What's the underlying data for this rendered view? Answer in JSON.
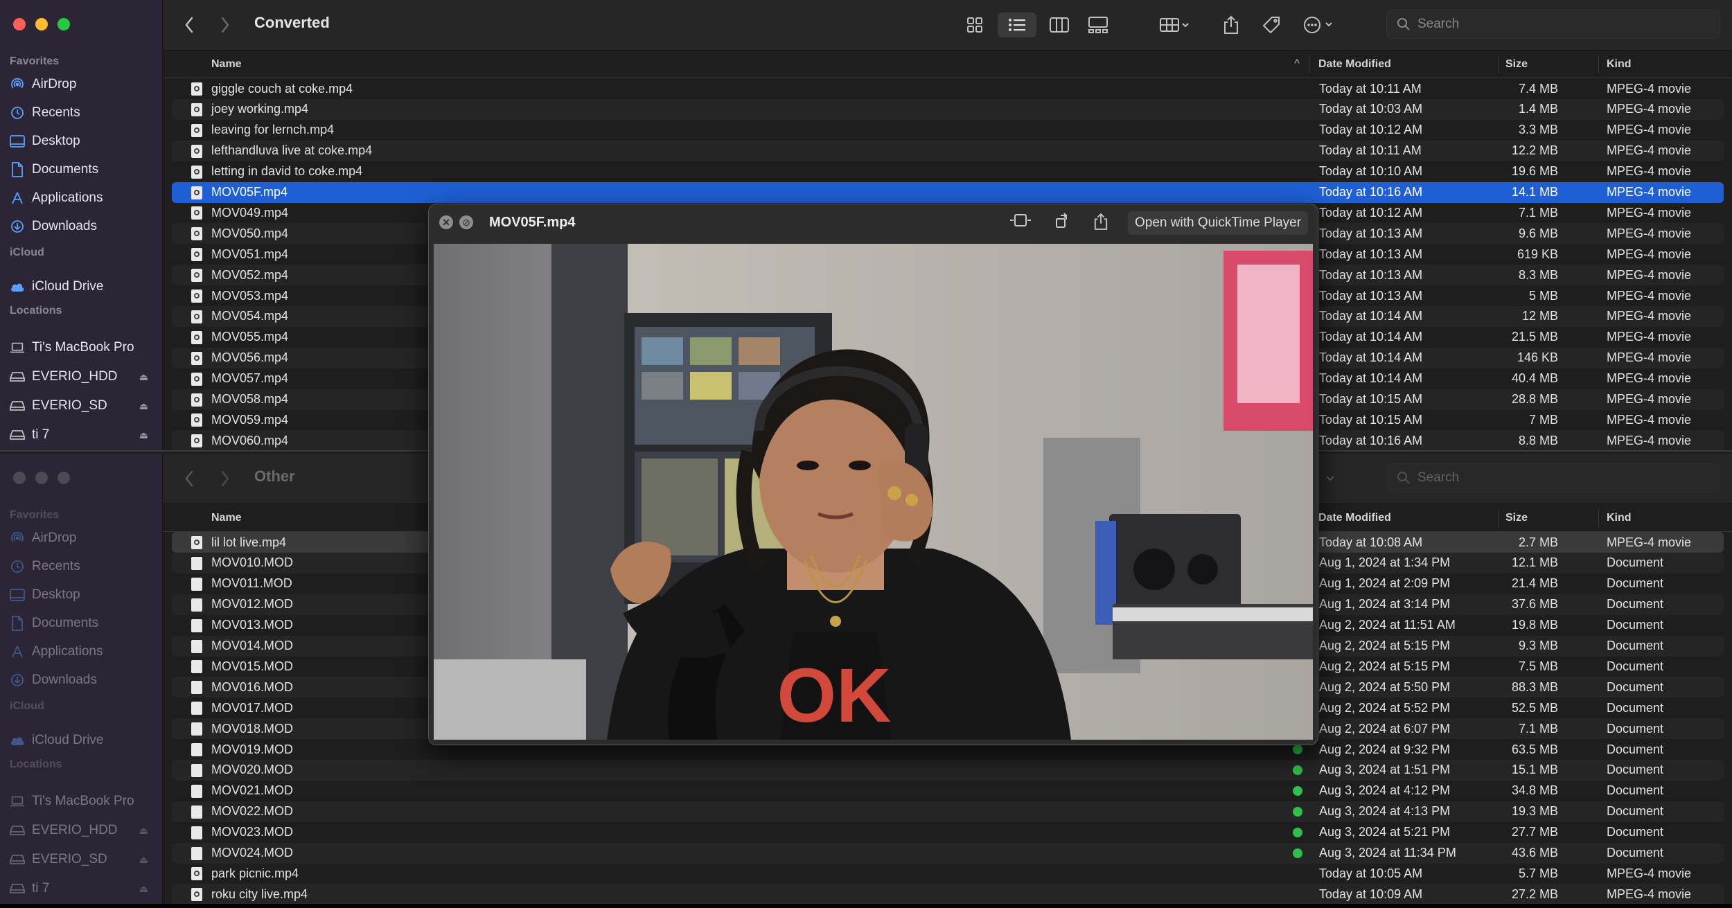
{
  "window1": {
    "title": "Converted",
    "search_placeholder": "Search",
    "columns": {
      "name": "Name",
      "date": "Date Modified",
      "size": "Size",
      "kind": "Kind"
    },
    "rows": [
      {
        "name": "giggle couch at coke.mp4",
        "date": "Today at 10:11 AM",
        "size": "7.4 MB",
        "kind": "MPEG-4 movie"
      },
      {
        "name": "joey working.mp4",
        "date": "Today at 10:03 AM",
        "size": "1.4 MB",
        "kind": "MPEG-4 movie"
      },
      {
        "name": "leaving for lernch.mp4",
        "date": "Today at 10:12 AM",
        "size": "3.3 MB",
        "kind": "MPEG-4 movie"
      },
      {
        "name": "lefthandluva live at coke.mp4",
        "date": "Today at 10:11 AM",
        "size": "12.2 MB",
        "kind": "MPEG-4 movie"
      },
      {
        "name": "letting in david to coke.mp4",
        "date": "Today at 10:10 AM",
        "size": "19.6 MB",
        "kind": "MPEG-4 movie"
      },
      {
        "name": "MOV05F.mp4",
        "date": "Today at 10:16 AM",
        "size": "14.1 MB",
        "kind": "MPEG-4 movie"
      },
      {
        "name": "MOV049.mp4",
        "date": "Today at 10:12 AM",
        "size": "7.1 MB",
        "kind": "MPEG-4 movie"
      },
      {
        "name": "MOV050.mp4",
        "date": "Today at 10:13 AM",
        "size": "9.6 MB",
        "kind": "MPEG-4 movie"
      },
      {
        "name": "MOV051.mp4",
        "date": "Today at 10:13 AM",
        "size": "619 KB",
        "kind": "MPEG-4 movie"
      },
      {
        "name": "MOV052.mp4",
        "date": "Today at 10:13 AM",
        "size": "8.3 MB",
        "kind": "MPEG-4 movie"
      },
      {
        "name": "MOV053.mp4",
        "date": "Today at 10:13 AM",
        "size": "5 MB",
        "kind": "MPEG-4 movie"
      },
      {
        "name": "MOV054.mp4",
        "date": "Today at 10:14 AM",
        "size": "12 MB",
        "kind": "MPEG-4 movie"
      },
      {
        "name": "MOV055.mp4",
        "date": "Today at 10:14 AM",
        "size": "21.5 MB",
        "kind": "MPEG-4 movie"
      },
      {
        "name": "MOV056.mp4",
        "date": "Today at 10:14 AM",
        "size": "146 KB",
        "kind": "MPEG-4 movie"
      },
      {
        "name": "MOV057.mp4",
        "date": "Today at 10:14 AM",
        "size": "40.4 MB",
        "kind": "MPEG-4 movie"
      },
      {
        "name": "MOV058.mp4",
        "date": "Today at 10:15 AM",
        "size": "28.8 MB",
        "kind": "MPEG-4 movie"
      },
      {
        "name": "MOV059.mp4",
        "date": "Today at 10:15 AM",
        "size": "7 MB",
        "kind": "MPEG-4 movie"
      },
      {
        "name": "MOV060.mp4",
        "date": "Today at 10:16 AM",
        "size": "8.8 MB",
        "kind": "MPEG-4 movie"
      }
    ]
  },
  "window2": {
    "title": "Other",
    "search_placeholder": "Search",
    "columns": {
      "name": "Name",
      "date": "Date Modified",
      "size": "Size",
      "kind": "Kind"
    },
    "rows": [
      {
        "name": "lil lot live.mp4",
        "date": "Today at 10:08 AM",
        "size": "2.7 MB",
        "kind": "MPEG-4 movie",
        "tag": false
      },
      {
        "name": "MOV010.MOD",
        "date": "Aug 1, 2024 at 1:34 PM",
        "size": "12.1 MB",
        "kind": "Document",
        "tag": false
      },
      {
        "name": "MOV011.MOD",
        "date": "Aug 1, 2024 at 2:09 PM",
        "size": "21.4 MB",
        "kind": "Document",
        "tag": false
      },
      {
        "name": "MOV012.MOD",
        "date": "Aug 1, 2024 at 3:14 PM",
        "size": "37.6 MB",
        "kind": "Document",
        "tag": false
      },
      {
        "name": "MOV013.MOD",
        "date": "Aug 2, 2024 at 11:51 AM",
        "size": "19.8 MB",
        "kind": "Document",
        "tag": false
      },
      {
        "name": "MOV014.MOD",
        "date": "Aug 2, 2024 at 5:15 PM",
        "size": "9.3 MB",
        "kind": "Document",
        "tag": false
      },
      {
        "name": "MOV015.MOD",
        "date": "Aug 2, 2024 at 5:15 PM",
        "size": "7.5 MB",
        "kind": "Document",
        "tag": false
      },
      {
        "name": "MOV016.MOD",
        "date": "Aug 2, 2024 at 5:50 PM",
        "size": "88.3 MB",
        "kind": "Document",
        "tag": false
      },
      {
        "name": "MOV017.MOD",
        "date": "Aug 2, 2024 at 5:52 PM",
        "size": "52.5 MB",
        "kind": "Document",
        "tag": false
      },
      {
        "name": "MOV018.MOD",
        "date": "Aug 2, 2024 at 6:07 PM",
        "size": "7.1 MB",
        "kind": "Document",
        "tag": false
      },
      {
        "name": "MOV019.MOD",
        "date": "Aug 2, 2024 at 9:32 PM",
        "size": "63.5 MB",
        "kind": "Document",
        "tag": true
      },
      {
        "name": "MOV020.MOD",
        "date": "Aug 3, 2024 at 1:51 PM",
        "size": "15.1 MB",
        "kind": "Document",
        "tag": true
      },
      {
        "name": "MOV021.MOD",
        "date": "Aug 3, 2024 at 4:12 PM",
        "size": "34.8 MB",
        "kind": "Document",
        "tag": true
      },
      {
        "name": "MOV022.MOD",
        "date": "Aug 3, 2024 at 4:13 PM",
        "size": "19.3 MB",
        "kind": "Document",
        "tag": true
      },
      {
        "name": "MOV023.MOD",
        "date": "Aug 3, 2024 at 5:21 PM",
        "size": "27.7 MB",
        "kind": "Document",
        "tag": true
      },
      {
        "name": "MOV024.MOD",
        "date": "Aug 3, 2024 at 11:34 PM",
        "size": "43.6 MB",
        "kind": "Document",
        "tag": true
      },
      {
        "name": "park picnic.mp4",
        "date": "Today at 10:05 AM",
        "size": "5.7 MB",
        "kind": "MPEG-4 movie",
        "tag": false
      },
      {
        "name": "roku city live.mp4",
        "date": "Today at 10:09 AM",
        "size": "27.2 MB",
        "kind": "MPEG-4 movie",
        "tag": false
      }
    ]
  },
  "sidebar": {
    "favorites_header": "Favorites",
    "favorites": [
      {
        "label": "AirDrop",
        "icon": "airdrop-icon"
      },
      {
        "label": "Recents",
        "icon": "clock-icon"
      },
      {
        "label": "Desktop",
        "icon": "desktop-icon"
      },
      {
        "label": "Documents",
        "icon": "document-icon"
      },
      {
        "label": "Applications",
        "icon": "applications-icon"
      },
      {
        "label": "Downloads",
        "icon": "download-icon"
      }
    ],
    "icloud_header": "iCloud",
    "icloud": [
      {
        "label": "iCloud Drive",
        "icon": "cloud-icon"
      }
    ],
    "locations_header": "Locations",
    "locations": [
      {
        "label": "Ti's MacBook Pro",
        "icon": "laptop-icon",
        "eject": false
      },
      {
        "label": "EVERIO_HDD",
        "icon": "drive-icon",
        "eject": true
      },
      {
        "label": "EVERIO_SD",
        "icon": "drive-icon",
        "eject": true
      },
      {
        "label": "ti 7",
        "icon": "drive-icon",
        "eject": true
      }
    ]
  },
  "preview": {
    "title": "MOV05F.mp4",
    "open_with": "Open with QuickTime Player",
    "video_overlay_text": "OK"
  },
  "colors": {
    "accent": "#1f5fd6",
    "sidebar_bg": "#2b2536",
    "sidebar_icon": "#5aa0ff",
    "tag_green": "#2fc04a"
  }
}
